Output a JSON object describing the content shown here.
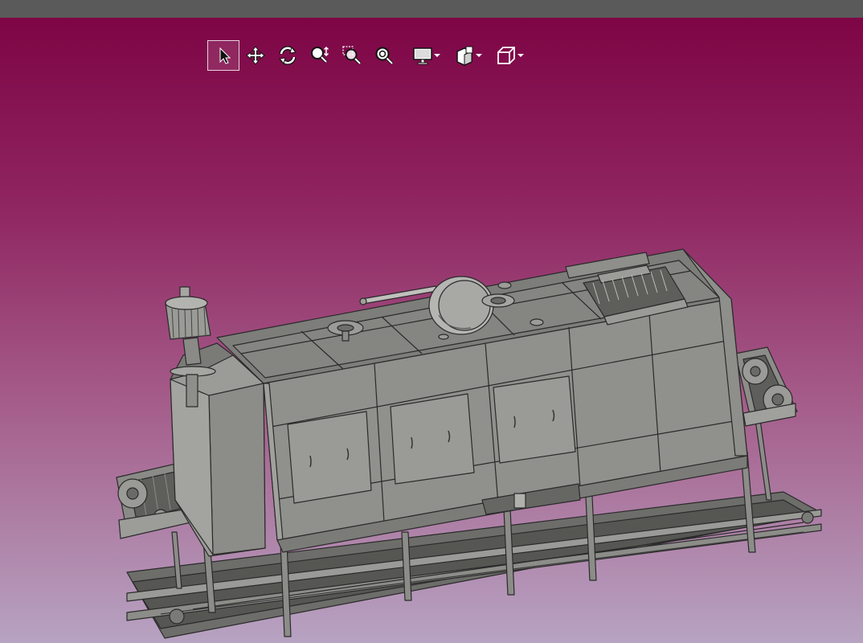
{
  "window": {
    "title": ""
  },
  "toolbar": {
    "buttons": [
      {
        "name": "select",
        "icon": "select-arrow-icon",
        "active": true
      },
      {
        "name": "pan",
        "icon": "pan-move-icon"
      },
      {
        "name": "rotate",
        "icon": "rotate-icon"
      },
      {
        "name": "zoom",
        "icon": "zoom-icon"
      },
      {
        "name": "zoom-window",
        "icon": "zoom-window-icon"
      },
      {
        "name": "fit-all",
        "icon": "zoom-fit-icon"
      },
      {
        "name": "display-mode",
        "icon": "monitor-icon",
        "has_dropdown": true
      },
      {
        "name": "render-style",
        "icon": "shaded-box-icon",
        "has_dropdown": true
      },
      {
        "name": "view-orientation",
        "icon": "cube-icon",
        "has_dropdown": true
      }
    ]
  },
  "colors": {
    "title_bar": "#5a5a5a",
    "background_top": "#7e0545",
    "background_bottom": "#b7a3c2",
    "model_gray": "#8c8c88",
    "edge": "#2a2a2a"
  },
  "model": {
    "name": "tunnel-oven-conveyor-assembly"
  }
}
